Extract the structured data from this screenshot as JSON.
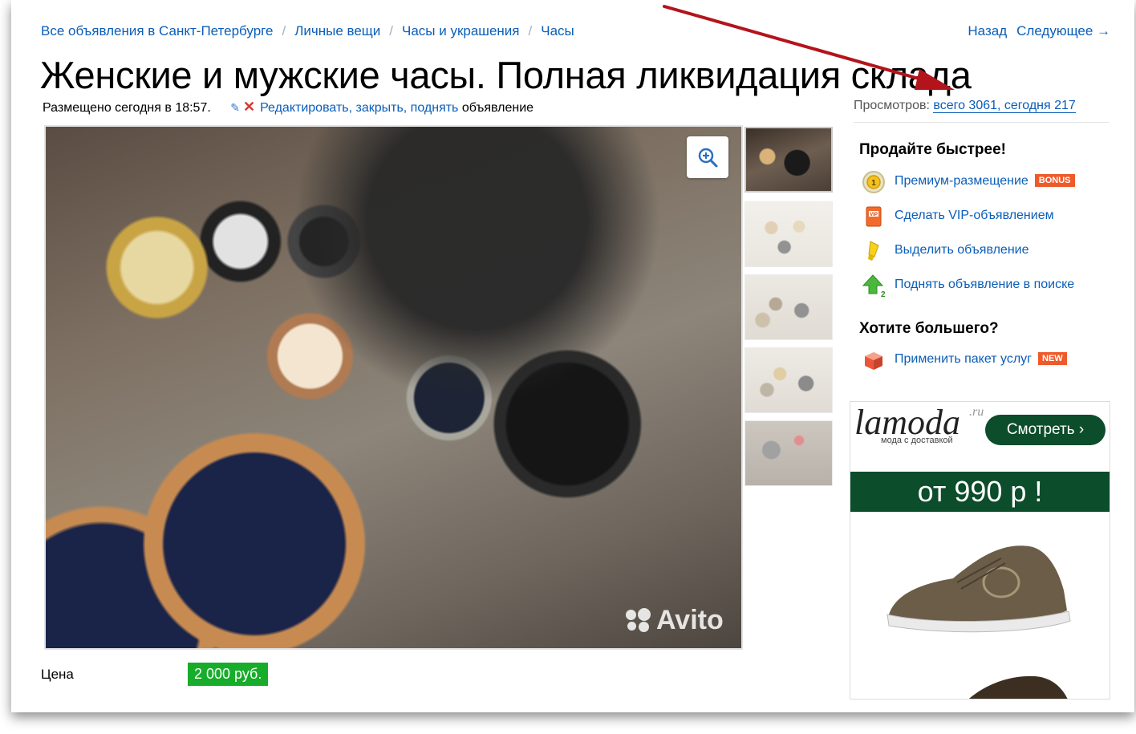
{
  "breadcrumb": {
    "items": [
      "Все объявления в Санкт-Петербурге",
      "Личные вещи",
      "Часы и украшения",
      "Часы"
    ],
    "separator": "/"
  },
  "nav": {
    "back": "Назад",
    "next": "Следующее →"
  },
  "listing": {
    "title": "Женские и мужские часы. Полная ликвидация склада",
    "posted": "Размещено сегодня в 18:57.",
    "edit_links": "Редактировать, закрыть, поднять",
    "edit_suffix": "объявление",
    "views_label": "Просмотров:",
    "views_value": "всего 3061, сегодня 217",
    "price_label": "Цена",
    "price": "2 000 руб.",
    "watermark": "Avito"
  },
  "sidebar": {
    "sell_faster_title": "Продайте быстрее!",
    "services": [
      {
        "label": "Премиум-размещение",
        "icon": "premium-coin-icon",
        "badge": "BONUS"
      },
      {
        "label": "Сделать VIP-объявлением",
        "icon": "vip-icon"
      },
      {
        "label": "Выделить объявление",
        "icon": "highlighter-icon"
      },
      {
        "label": "Поднять объявление в поиске",
        "icon": "raise-arrow-icon"
      }
    ],
    "want_more_title": "Хотите большего?",
    "package": {
      "label": "Применить пакет услуг",
      "icon": "package-icon",
      "badge": "NEW"
    }
  },
  "ad": {
    "brand": "lamoda",
    "brand_suffix": ".ru",
    "tagline": "мода с доставкой",
    "cta": "Смотреть ›",
    "price_text": "от 990 р !"
  },
  "colors": {
    "link": "#0a5db8",
    "price_bg": "#17ad2a",
    "ad_green": "#0c4d2b",
    "badge": "#ef5a2b",
    "annotation_arrow": "#b3141c"
  }
}
